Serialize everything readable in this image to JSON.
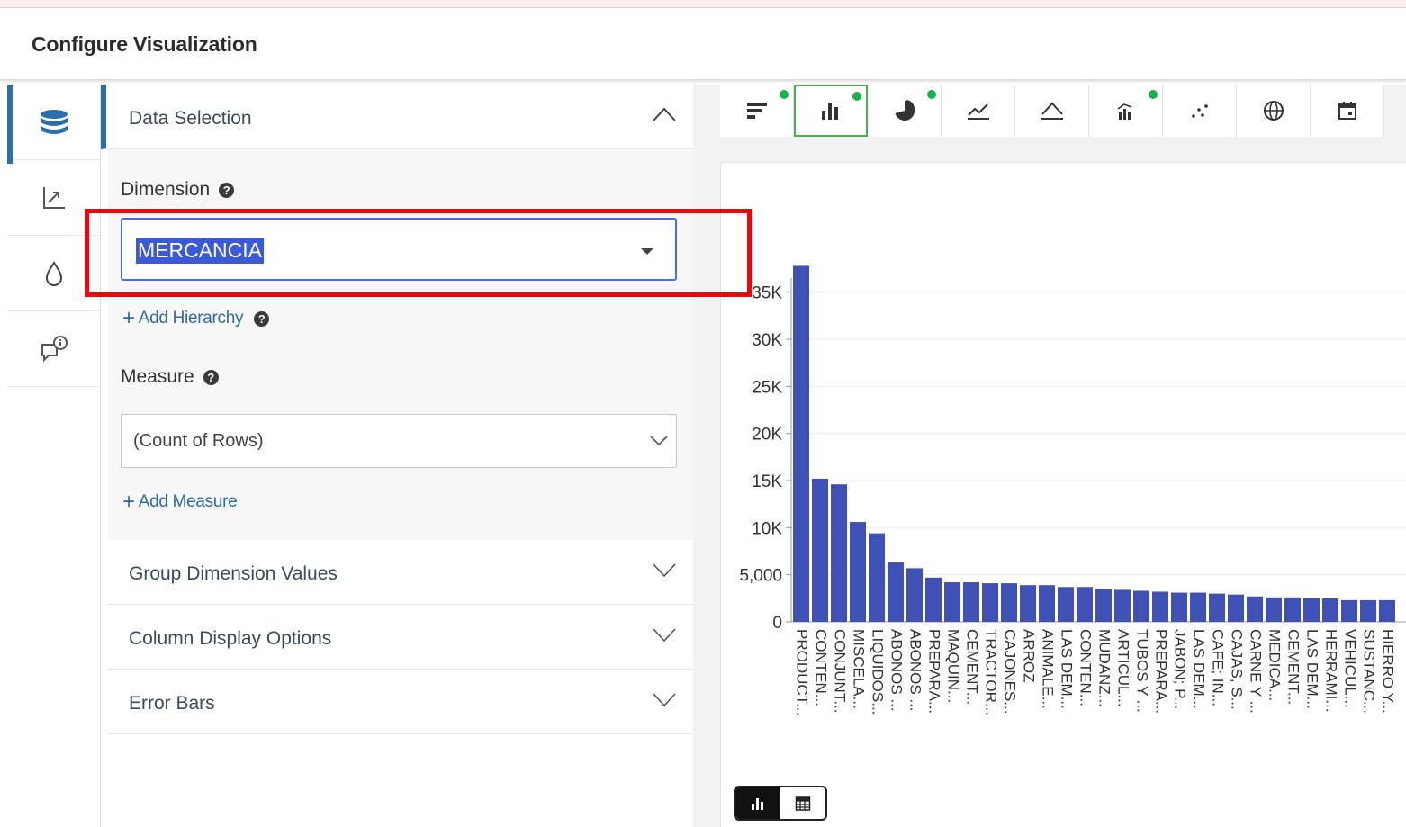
{
  "header": {
    "title": "Configure Visualization"
  },
  "rail": {
    "tabs": [
      {
        "icon": "database-icon",
        "active": true
      },
      {
        "icon": "axis-chart-icon",
        "active": false
      },
      {
        "icon": "drop-icon",
        "active": false
      },
      {
        "icon": "comment-info-icon",
        "active": false
      }
    ]
  },
  "panel": {
    "data_selection": {
      "title": "Data Selection",
      "dimension_label": "Dimension",
      "dimension_value": "MERCANCIA",
      "add_hierarchy": "Add Hierarchy",
      "measure_label": "Measure",
      "measure_value": "(Count of Rows)",
      "add_measure": "Add Measure"
    },
    "sections": [
      {
        "title": "Group Dimension Values"
      },
      {
        "title": "Column Display Options"
      },
      {
        "title": "Error Bars"
      }
    ]
  },
  "toolbar": {
    "items": [
      {
        "icon": "horizontal-bar-chart-icon",
        "active": false,
        "dot": true
      },
      {
        "icon": "column-chart-icon",
        "active": true,
        "dot": true
      },
      {
        "icon": "pie-chart-icon",
        "active": false,
        "dot": true
      },
      {
        "icon": "line-chart-icon",
        "active": false,
        "dot": false
      },
      {
        "icon": "area-chart-icon",
        "active": false,
        "dot": false
      },
      {
        "icon": "combo-chart-icon",
        "active": false,
        "dot": true
      },
      {
        "icon": "scatter-chart-icon",
        "active": false,
        "dot": false
      },
      {
        "icon": "globe-map-icon",
        "active": false,
        "dot": false
      },
      {
        "icon": "calendar-icon",
        "active": false,
        "dot": false
      }
    ]
  },
  "colors": {
    "bar": "#3f51b5",
    "accent": "#2a6fa8",
    "highlight_frame": "#e8090a",
    "active_dot": "#1ab34a"
  },
  "view_toggle": {
    "active": "chart-icon",
    "other": "table-icon"
  },
  "chart_data": {
    "type": "bar",
    "ylim": [
      0,
      36500
    ],
    "yticks": [
      {
        "value": 0,
        "label": "0"
      },
      {
        "value": 5000,
        "label": "5,000"
      },
      {
        "value": 10000,
        "label": "10K"
      },
      {
        "value": 15000,
        "label": "15K"
      },
      {
        "value": 20000,
        "label": "20K"
      },
      {
        "value": 25000,
        "label": "25K"
      },
      {
        "value": 30000,
        "label": "30K"
      },
      {
        "value": 35000,
        "label": "35K"
      }
    ],
    "grid": true,
    "categories": [
      "PRODUCT...",
      "CONTEN...",
      "CONJUNT...",
      "MISCELA...",
      "LIQUIDOS...",
      "ABONOS ...",
      "ABONOS ...",
      "PREPARA...",
      "MAQUIN...",
      "CEMENT...",
      "TRACTOR...",
      "CAJONES...",
      "ARROZ",
      "ANIMALE...",
      "LAS DEM...",
      "CONTEN...",
      "MUDANZ...",
      "ARTICUL...",
      "TUBOS Y ...",
      "PREPARA...",
      "JABON; P...",
      "LAS DEM...",
      "CAFE; IN...",
      "CAJAS, S...",
      "CARNE Y ...",
      "MEDICA...",
      "CEMENT...",
      "LAS DEM...",
      "HERRAMI...",
      "VEHICUL...",
      "SUSTANC...",
      "HIERRO Y..."
    ],
    "values": [
      37800,
      15200,
      14600,
      10600,
      9400,
      6300,
      5700,
      4700,
      4200,
      4200,
      4100,
      4100,
      3900,
      3900,
      3700,
      3700,
      3500,
      3400,
      3300,
      3200,
      3100,
      3100,
      3000,
      2900,
      2700,
      2600,
      2600,
      2500,
      2500,
      2300,
      2300,
      2300
    ]
  }
}
